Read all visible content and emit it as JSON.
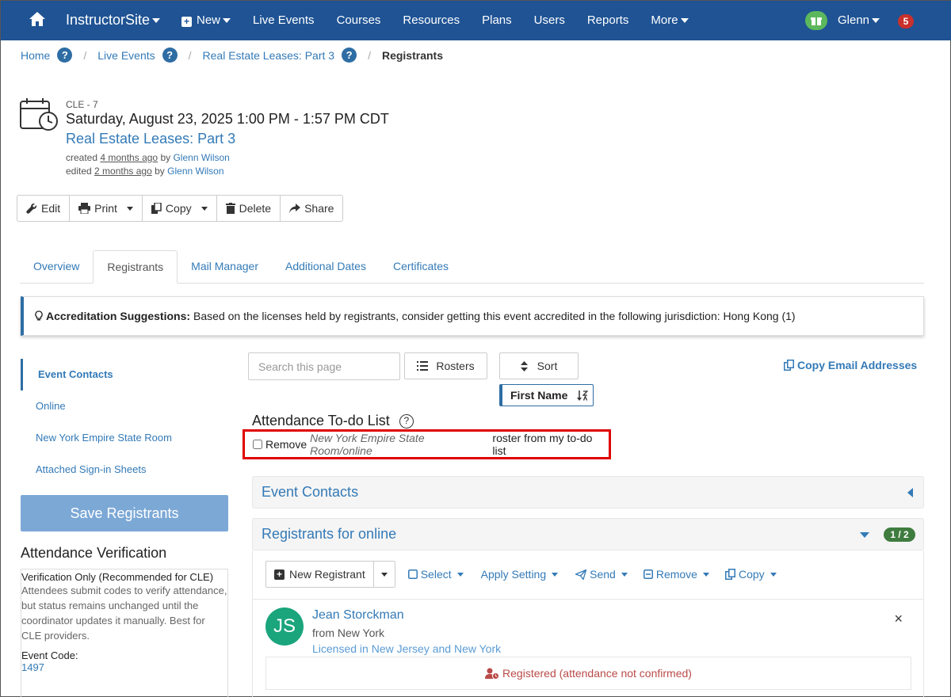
{
  "navbar": {
    "brand": "InstructorSite",
    "items": [
      "New",
      "Live Events",
      "Courses",
      "Resources",
      "Plans",
      "Users",
      "Reports",
      "More"
    ],
    "user": "Glenn",
    "notifications": "5"
  },
  "breadcrumb": {
    "home": "Home",
    "live_events": "Live Events",
    "event": "Real Estate Leases: Part 3",
    "current": "Registrants",
    "help": "?"
  },
  "event": {
    "code": "CLE - 7",
    "date": "Saturday, August 23, 2025 1:00 PM - 1:57 PM CDT",
    "title": "Real Estate Leases: Part 3",
    "created_prefix": "created",
    "created_ago": "4 months ago",
    "created_by": "by",
    "created_user": "Glenn Wilson",
    "edited_prefix": "edited",
    "edited_ago": "2 months ago",
    "edited_by": "by",
    "edited_user": "Glenn Wilson"
  },
  "toolbar": {
    "edit": "Edit",
    "print": "Print",
    "copy": "Copy",
    "delete": "Delete",
    "share": "Share"
  },
  "tabs": [
    "Overview",
    "Registrants",
    "Mail Manager",
    "Additional Dates",
    "Certificates"
  ],
  "alert": {
    "label": "Accreditation Suggestions:",
    "text": "Based on the licenses held by registrants, consider getting this event accredited in the following jurisdiction: Hong Kong (1)"
  },
  "sidebar": {
    "items": [
      "Event Contacts",
      "Online",
      "New York Empire State Room",
      "Attached Sign-in Sheets"
    ],
    "save": "Save Registrants",
    "verification_title": "Attendance Verification",
    "verification_mode": "Verification Only (Recommended for CLE)",
    "verification_desc": "Attendees submit codes to verify attendance, but status remains unchanged until the coordinator updates it manually. Best for CLE providers.",
    "event_code_label": "Event Code:",
    "event_code": "1497"
  },
  "controls": {
    "search_placeholder": "Search this page",
    "rosters": "Rosters",
    "sort": "Sort",
    "sort_field": "First Name",
    "copy_emails": "Copy Email Addresses"
  },
  "todo": {
    "title": "Attendance To-do List",
    "help": "?",
    "prefix": "Remove",
    "roster": "New York Empire State Room/online",
    "suffix": "roster from my to-do list"
  },
  "panels": {
    "contacts": "Event Contacts",
    "registrants": "Registrants for online",
    "count": "1 / 2"
  },
  "reg_toolbar": {
    "new_registrant": "New Registrant",
    "select": "Select",
    "apply": "Apply Setting",
    "send": "Send",
    "remove": "Remove",
    "copy": "Copy"
  },
  "registrant": {
    "initials": "JS",
    "name": "Jean Storckman",
    "from": "from New York",
    "licensed": "Licensed in New Jersey and New York",
    "status": "Registered (attendance not confirmed)",
    "close": "×"
  }
}
